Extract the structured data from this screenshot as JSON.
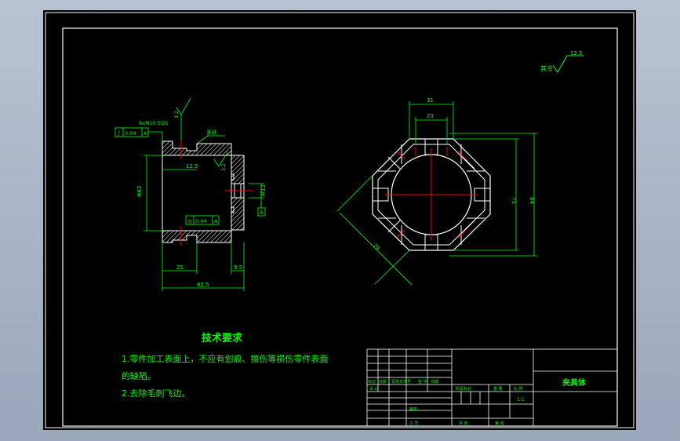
{
  "colors": {
    "background": "#000000",
    "outline": "#ffffff",
    "dimension": "#00ff00",
    "centerline": "#ff0000",
    "hatch": "#ffffff",
    "window_frame": "#a6b2c4"
  },
  "roughness": {
    "corner_label": "其余",
    "corner_value": "12.5",
    "left_top": "3.2",
    "left_mid": "3.2"
  },
  "left_view": {
    "fcf_top_symbol": "∫",
    "fcf_top_value": "0.04",
    "fcf_top_datum": "A",
    "fcf_bottom_symbol": "◎",
    "fcf_bottom_value": "0.04",
    "fcf_bottom_datum": "A",
    "callout_top": "6xM10 EQS",
    "inner_dim": "12.5",
    "bore_dim": "Φ82",
    "hole_dim": "M12",
    "datum": "A",
    "bottom_dim_1": "25",
    "bottom_dim_2": "9.5",
    "bottom_dim_total": "82.5",
    "leader_note": "多处"
  },
  "right_view": {
    "top_dim_outer": "31",
    "top_dim_inner": "23",
    "right_dim_inner": "75",
    "right_dim_outer": "84",
    "diag_dim": "79"
  },
  "tech_requirements": {
    "title": "技术要求",
    "line1": "1.零件加工表面上，不应有划痕、擦伤等损伤零件表面",
    "line2": "的缺陷。",
    "line3": "2.去除毛刺飞边。"
  },
  "title_block": {
    "part_name": "夹具体",
    "scale": "1:1",
    "h_mark": "标记",
    "h_count": "处数",
    "h_zone": "更改文件号",
    "h_sign": "签 字",
    "h_date": "日期",
    "h_design": "设 计",
    "h_stage": "阶段标记",
    "h_weight": "重 量",
    "h_ratio": "比 例",
    "h_review": "审核",
    "h_craft": "工 艺",
    "h_sheets": "共 张",
    "h_sheet": "第 张"
  }
}
